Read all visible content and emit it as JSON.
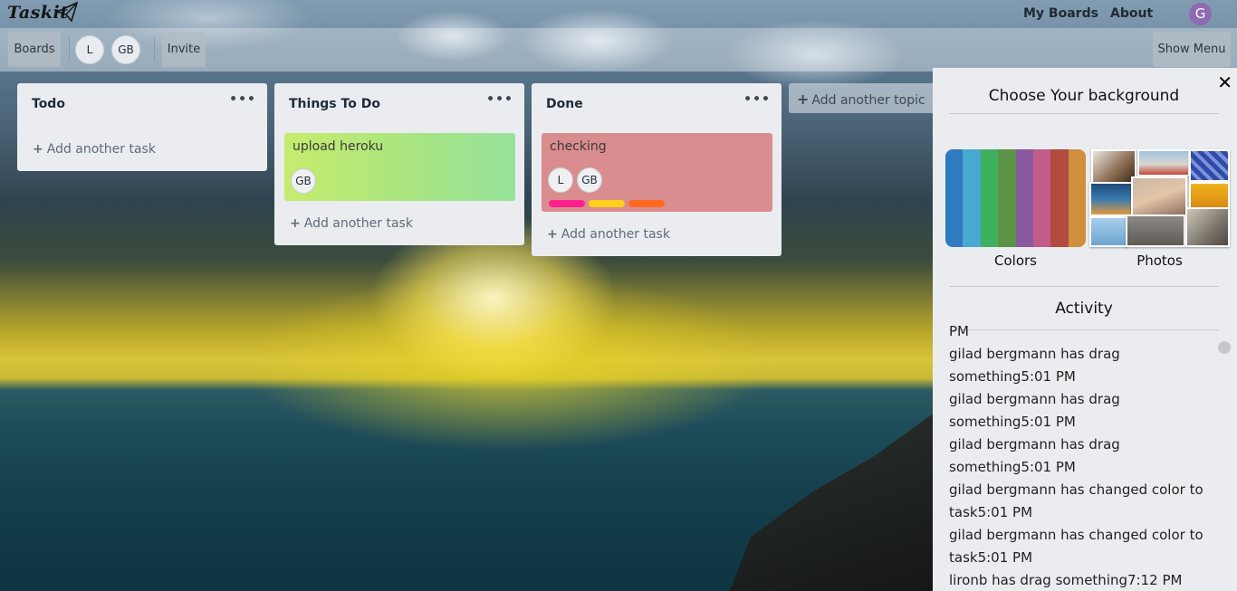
{
  "app": {
    "logo_text": "Taskit",
    "nav": {
      "my_boards": "My Boards",
      "about": "About",
      "user_initial": "G"
    },
    "colors": {
      "avatar": "#8e6ab3",
      "list_bg": "#ebecf0"
    }
  },
  "boardbar": {
    "boards_label": "Boards",
    "members": [
      "L",
      "GB"
    ],
    "invite_label": "Invite",
    "show_menu_label": "Show Menu"
  },
  "lists": [
    {
      "title": "Todo",
      "menu": "•••",
      "add_task": "Add another task",
      "cards": []
    },
    {
      "title": "Things To Do",
      "menu": "•••",
      "add_task": "Add another task",
      "cards": [
        {
          "title": "upload heroku",
          "members": [
            "GB"
          ],
          "labels": []
        }
      ]
    },
    {
      "title": "Done",
      "menu": "•••",
      "add_task": "Add another task",
      "cards": [
        {
          "title": "checking",
          "members": [
            "L",
            "GB"
          ],
          "labels": [
            "#ff1f8e",
            "#ffd11a",
            "#ff6a21"
          ]
        }
      ]
    }
  ],
  "add_topic": "Add another topic",
  "side_menu": {
    "close": "✕",
    "background_heading": "Choose Your background",
    "colors_label": "Colors",
    "photos_label": "Photos",
    "swatch_colors": [
      "#2f7bbf",
      "#48a9d2",
      "#3fb060",
      "#5b9446",
      "#8a5aa0",
      "#c15b8a",
      "#b04b3d",
      "#cf8f3c"
    ],
    "activity_heading": "Activity",
    "activity": [
      "PM",
      "gilad bergmann has drag something5:01 PM",
      "gilad bergmann has drag something5:01 PM",
      "gilad bergmann has drag something5:01 PM",
      "gilad bergmann has changed color to task5:01 PM",
      "gilad bergmann has changed color to task5:01 PM",
      "lironb has drag something7:12 PM"
    ]
  }
}
